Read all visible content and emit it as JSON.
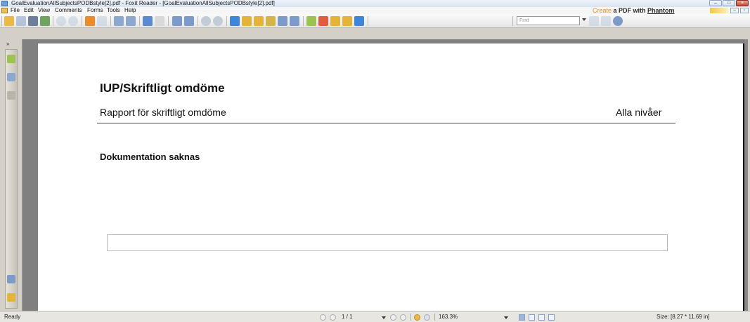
{
  "window": {
    "title": "GoalEvaluationAllSubjectsPODBstyle[2].pdf - Foxit Reader - [GoalEvaluationAllSubjectsPODBstyle[2].pdf]",
    "min_label": "–",
    "max_label": "□",
    "close_label": "×"
  },
  "menu": {
    "items": [
      "File",
      "Edit",
      "View",
      "Comments",
      "Forms",
      "Tools",
      "Help"
    ],
    "promo_part1": "Create",
    "promo_part2": " a PDF with ",
    "promo_part3": "Phantom",
    "mdi_min": "–",
    "mdi_restore": "▫"
  },
  "toolbar": {
    "find_placeholder": "Find",
    "colors": {
      "open": "#e9b949",
      "save": "#7a97c6",
      "print": "#6d7f99",
      "email": "#6fa35f",
      "nav": "#e98a2c",
      "zoom": "#5a8bd0",
      "hand": "#3f86d8",
      "select": "#e3b33a",
      "annot": "#9cc252"
    }
  },
  "document": {
    "heading": "IUP/Skriftligt omdöme",
    "subtitle": "Rapport för skriftligt omdöme",
    "level": "Alla nivåer",
    "section": "Dokumentation saknas"
  },
  "status": {
    "ready": "Ready",
    "page": "1 / 1",
    "zoom": "163.3%",
    "size": "Size: [8.27 * 11.69 in]"
  }
}
